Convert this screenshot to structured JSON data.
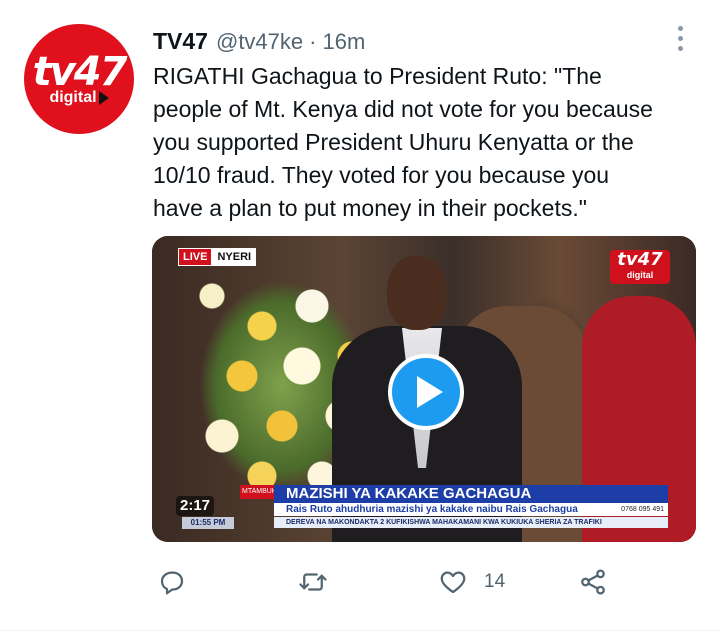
{
  "tweet": {
    "author": {
      "name": "TV47",
      "handle": "@tv47ke",
      "separator": "·",
      "time": "16m",
      "avatar_logo_main": "tv47",
      "avatar_logo_sub": "digital"
    },
    "text": "RIGATHI Gachagua to President Ruto: \"The\npeople of Mt. Kenya did not vote for you because\nyou supported President Uhuru Kenyatta or the\n10/10 fraud. They voted for you because you\nhave a plan to put money in their pockets.\"",
    "media": {
      "type": "video",
      "duration": "2:17",
      "live_label": "LIVE",
      "location_label": "NYERI",
      "channel_logo_main": "tv47",
      "channel_logo_sub": "digital",
      "headline": "MAZISHI YA KAKAKE GACHAGUA",
      "subline": "Rais Ruto ahudhuria mazishi ya kakake naibu Rais Gachagua",
      "ticker": "DEREVA NA MAKONDAKTA 2 KUFIKISHWA MAHAKAMANI KWA KUKIUKA SHERIA ZA TRAFIKI",
      "left_tag": "MTAMBUKO",
      "phone": "0768 095 491",
      "clock": "01:55 PM"
    },
    "actions": {
      "reply_icon": "reply-icon",
      "retweet_icon": "retweet-icon",
      "like_icon": "heart-icon",
      "like_count": "14",
      "share_icon": "share-icon"
    },
    "colors": {
      "accent": "#1d9bf0",
      "brand_red": "#e0101d",
      "secondary_text": "#536471"
    }
  }
}
